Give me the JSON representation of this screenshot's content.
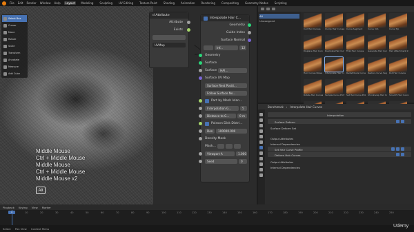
{
  "menu": {
    "items": [
      "File",
      "Edit",
      "Render",
      "Window",
      "Help"
    ],
    "workspaces": [
      "Layout",
      "Modeling",
      "Sculpting",
      "UV Editing",
      "Texture Paint",
      "Shading",
      "Animation",
      "Rendering",
      "Compositing",
      "Geometry Nodes",
      "Scripting"
    ],
    "active_workspace": "Layout"
  },
  "tools": [
    {
      "label": "Select Box",
      "active": true
    },
    {
      "label": "Cursor",
      "active": false
    },
    {
      "label": "Move",
      "active": false
    },
    {
      "label": "Rotate",
      "active": false
    },
    {
      "label": "Scale",
      "active": false
    },
    {
      "label": "Transform",
      "active": false
    },
    {
      "label": "Annotate",
      "active": false
    },
    {
      "label": "Measure",
      "active": false
    },
    {
      "label": "Add Cube",
      "active": false
    }
  ],
  "overlay_keys": [
    "Middle Mouse",
    "Ctrl + Middle Mouse",
    "Middle Mouse",
    "Ctrl + Middle Mouse",
    "Middle Mouse x2"
  ],
  "alt_key": "Alt",
  "nodes": {
    "left_node": {
      "title": "d Attribute",
      "rows": [
        "Attribute",
        "Exists"
      ],
      "uvmap": "UVMap"
    },
    "main_node": {
      "title": "Interpolate Hair C...",
      "outputs": [
        "Geometry",
        "Guide Index",
        "Surface Normal"
      ],
      "mode": "Inf...",
      "mode_value": "12",
      "inputs": [
        "Geometry",
        "Surface",
        "Surface",
        "Surface UV Map",
        "Surface Rest Positi...",
        "Follow Surface No...",
        "Part by Mesh Islan...",
        "Interpolation G...",
        "Distance to G...",
        "Poisson Disk Distri...",
        "Den",
        "Density Mask",
        "Mask...",
        "Viewport A",
        "Seed"
      ],
      "surface_value": "HAI...",
      "interp_value": "5",
      "dist_value": "0 m",
      "den_value": "100000.000",
      "viewport_value": "1.000",
      "seed_value": "0"
    }
  },
  "asset_browser": {
    "tree": [
      "All",
      "Unassigned"
    ],
    "assets": [
      "Curl Hair Curves",
      "Clump Hair Curves",
      "Curve Segment",
      "Curve Info",
      "Curve Tip",
      "Displace Hair Curves",
      "Duplicate Hair Curves",
      "Frizz Hair Curves",
      "Generate Hair Curves",
      "Hair Attachment Info",
      "Hair Curves Noise",
      "Interpolate Hair Curves",
      "Redistribute Curve Points",
      "Restore Curve Segment",
      "Roll Hair Curves",
      "Rotate Hair Curves",
      "Sample Curve Profile",
      "Set Hair Curve Profile",
      "Shrinkwrap Hair Curves",
      "Smooth Hair Curves",
      "Straighten Hair Curves",
      "Trim Hair Curves",
      "Blend Hair Curves",
      "Braid Hair Curves",
      "Create Guide Index Map"
    ],
    "selected_index": 11
  },
  "properties": {
    "breadcrumb": [
      "Benchmark",
      "Interpolate Hair Curves"
    ],
    "modifier_label": "Interpolation",
    "rows": [
      "Surface Deform",
      "Surface Deform Set",
      "Output Attributes",
      "Internal Dependencies",
      "Set Hair Curve Profile",
      "Deform Hair Curves",
      "Output Attributes",
      "Internal Dependencies"
    ]
  },
  "timeline": {
    "menus": [
      "Playback",
      "Keying",
      "View",
      "Marker"
    ],
    "current_frame": "1",
    "frames": [
      "0",
      "10",
      "20",
      "30",
      "40",
      "50",
      "60",
      "70",
      "80",
      "90",
      "100",
      "110",
      "120",
      "130",
      "140",
      "150",
      "160",
      "170",
      "180",
      "190",
      "200",
      "210",
      "220",
      "230",
      "240",
      "250"
    ]
  },
  "status": {
    "left": "Select",
    "mid": "Pan View",
    "right": "Context Menu"
  },
  "watermark": "Udemy",
  "colors": {
    "accent": "#4772b3",
    "socket_green": "#2bd67a",
    "socket_purple": "#7a66d6",
    "blender_orange": "#e87d0d"
  }
}
